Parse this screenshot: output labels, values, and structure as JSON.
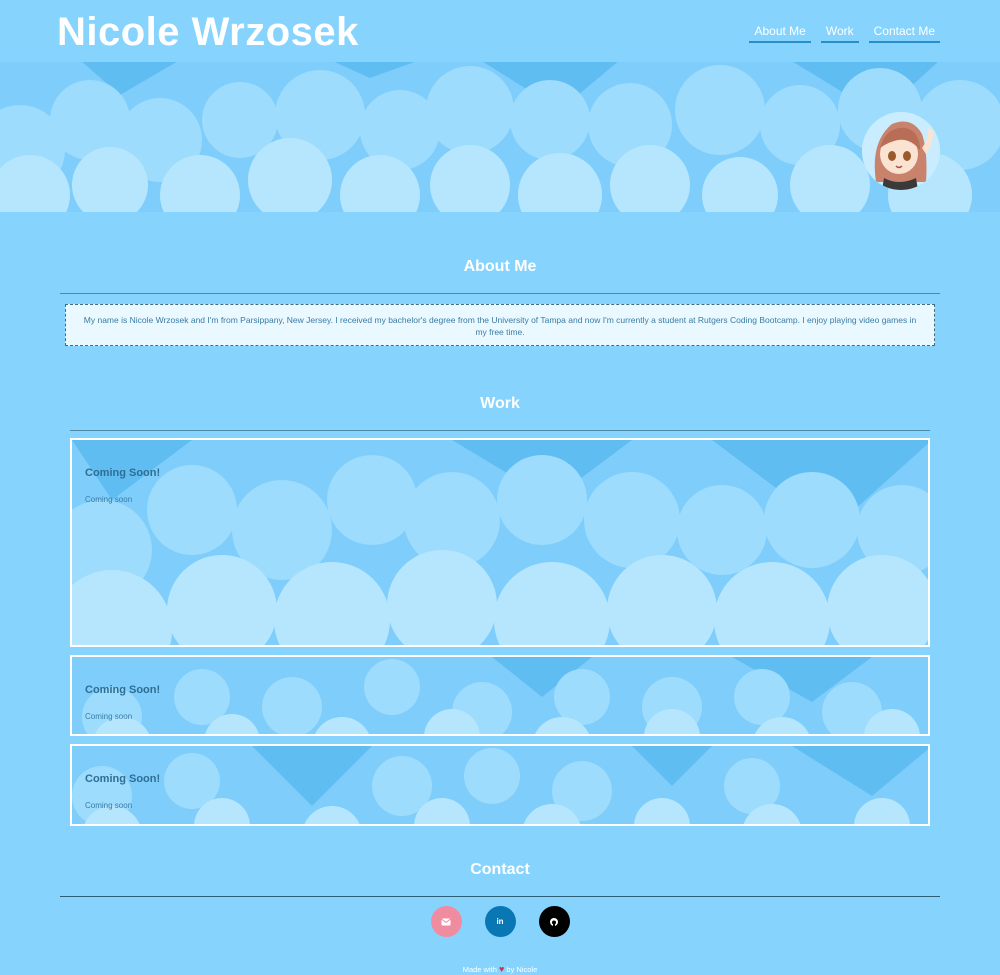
{
  "header": {
    "site_title": "Nicole Wrzosek",
    "nav": [
      {
        "label": "About Me"
      },
      {
        "label": "Work"
      },
      {
        "label": "Contact Me"
      }
    ]
  },
  "about": {
    "title": "About Me",
    "text": "My name is Nicole Wrzosek and I'm from Parsippany, New Jersey. I received my bachelor's degree from the University of Tampa and now I'm currently a student at Rutgers Coding Bootcamp. I enjoy playing video games in my free time."
  },
  "work": {
    "title": "Work",
    "cards": [
      {
        "title": "Coming Soon!",
        "desc": "Coming soon"
      },
      {
        "title": "Coming Soon!",
        "desc": "Coming soon"
      },
      {
        "title": "Coming Soon!",
        "desc": "Coming soon"
      }
    ]
  },
  "contact": {
    "title": "Contact",
    "links": [
      {
        "name": "email",
        "icon": "envelope-icon",
        "glyph": "✉",
        "color": "#f08ca0"
      },
      {
        "name": "linkedin",
        "icon": "linkedin-icon",
        "glyph": "in",
        "color": "#0a77b5"
      },
      {
        "name": "github",
        "icon": "github-icon",
        "glyph": "●",
        "color": "#000000"
      }
    ]
  },
  "footer": {
    "made_with": "Made with",
    "by": "by Nicole"
  }
}
